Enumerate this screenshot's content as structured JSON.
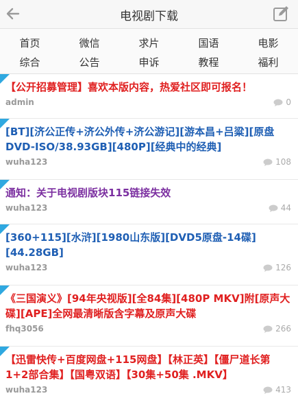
{
  "header": {
    "title": "电视剧下载",
    "back_icon": "back-arrow-icon",
    "edit_icon": "edit-post-icon"
  },
  "nav": {
    "row1": [
      "首页",
      "微信",
      "求片",
      "国语",
      "电影"
    ],
    "row2": [
      "综合",
      "公告",
      "申诉",
      "教程",
      "福利"
    ]
  },
  "colors": {
    "red": "#e02020",
    "blue": "#1f5fb4",
    "purple": "#7b2fa0",
    "accent": "#2fa8e0"
  },
  "threads": [
    {
      "title": "【公开招募管理】喜欢本版内容，热爱社区即可报名！",
      "author": "admin",
      "replies": "0",
      "color": "#e02020"
    },
    {
      "title": "[BT][济公正传+济公外传+济公游记][游本昌+吕粱][原盘DVD-ISO/38.93GB][480P][经典中的经典]",
      "author": "wuha123",
      "replies": "108",
      "color": "#1f5fb4"
    },
    {
      "title": "通知：关于电视剧版块115链接失效",
      "author": "wuha123",
      "replies": "44",
      "color": "#7b2fa0"
    },
    {
      "title": "[360+115][水浒][1980山东版][DVD5原盘-14碟][44.28GB]",
      "author": "wuha123",
      "replies": "126",
      "color": "#1f5fb4"
    },
    {
      "title": "《三国演义》[94年央视版][全84集][480P MKV]附[原声大碟][APE]全网最清晰版含字幕及原声大碟",
      "author": "fhq3056",
      "replies": "266",
      "color": "#e02020"
    },
    {
      "title": "【迅雷快传+百度网盘+115网盘】【林正英】【僵尸道长第1+2部合集】【国粤双语】【30集+50集 .MKV】",
      "author": "wuha123",
      "replies": "413",
      "color": "#e02020"
    }
  ]
}
